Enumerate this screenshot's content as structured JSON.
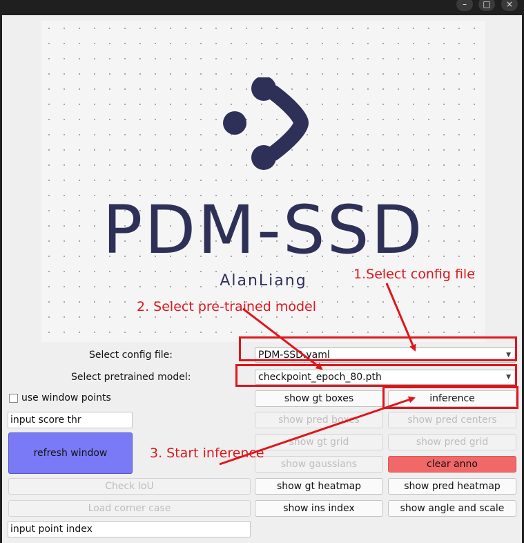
{
  "window": {
    "controls": {
      "minimize": "–",
      "maximize": "□",
      "close": "×"
    }
  },
  "logo": {
    "title": "PDM-SSD",
    "author": "AlanLiang"
  },
  "config": {
    "label": "Select config file:",
    "value": "PDM-SSD.yaml"
  },
  "model": {
    "label": "Select pretrained model:",
    "value": "checkpoint_epoch_80.pth"
  },
  "left_panel": {
    "use_window_points": "use window points",
    "score_thr_value": "input score thr",
    "refresh_window": "refresh window",
    "check_iou": "Check IoU",
    "load_corner_case": "Load corner case",
    "point_index_value": "input point index"
  },
  "buttons": {
    "show_gt_boxes": "show gt boxes",
    "inference": "inference",
    "show_pred_boxes": "show pred boxes",
    "show_pred_centers": "show pred centers",
    "show_gt_grid": "show gt grid",
    "show_pred_grid": "show pred grid",
    "show_gaussians": "show gaussians",
    "clear_anno": "clear anno",
    "show_gt_heatmap": "show gt heatmap",
    "show_pred_heatmap": "show pred heatmap",
    "show_ins_index": "show ins index",
    "show_angle_and_scale": "show angle and scale"
  },
  "annotations": {
    "step1": "1.Select config file",
    "step2": "2. Select pre-trained model",
    "step3": "3. Start inference"
  },
  "colors": {
    "annotation_red": "#e0151b",
    "refresh_blue": "#7a7af6",
    "clear_red": "#f26767",
    "logo_navy": "#2f3058"
  }
}
